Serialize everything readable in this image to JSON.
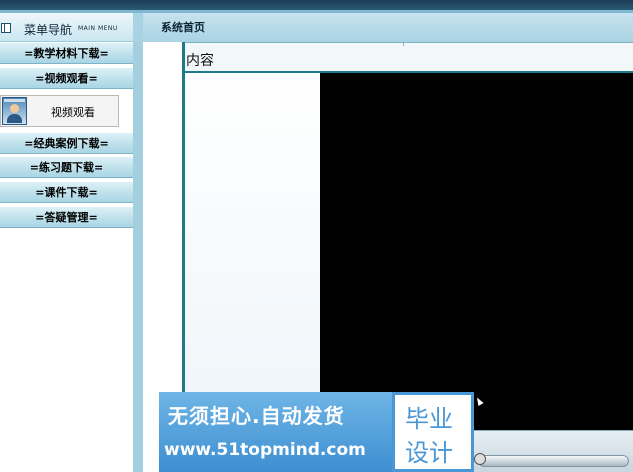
{
  "sidebar": {
    "title": "菜单导航",
    "subtitle": "MAIN MENU",
    "items": [
      {
        "label": "=教学材料下载="
      },
      {
        "label": "=视频观看="
      },
      {
        "label": "=经典案例下载="
      },
      {
        "label": "=练习题下载="
      },
      {
        "label": "=课件下载="
      },
      {
        "label": "=答疑管理="
      }
    ],
    "sub_item": {
      "label": "视频观看",
      "icon": "user-avatar-icon"
    }
  },
  "main": {
    "title": "系统首页",
    "frame_label": "内容"
  },
  "banner": {
    "slogan": "无须担心.自动发货",
    "url": "www.51topmind.com",
    "logo_line1": "毕业",
    "logo_line2": "设计"
  },
  "colors": {
    "nav_gradient_top": "#def1f7",
    "nav_gradient_bottom": "#a9d5e5",
    "frame_border": "#1f7a8c",
    "video_bg": "#000000",
    "banner_blue": "#3d8fd1"
  }
}
